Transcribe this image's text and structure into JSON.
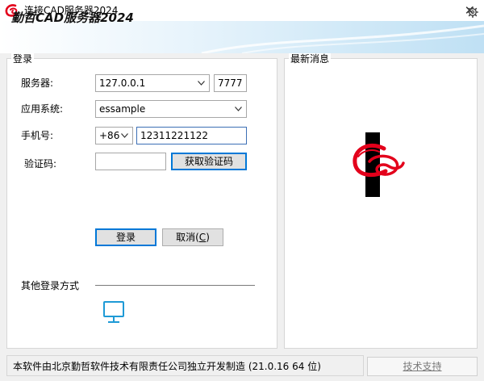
{
  "window": {
    "title": "连接CAD服务器2024",
    "close_glyph": "✕"
  },
  "banner": {
    "title": "勤哲CAD服务器2024",
    "settings_icon": "gear-icon"
  },
  "login": {
    "caption": "登录",
    "server_label": "服务器:",
    "server_value": "127.0.0.1",
    "port_value": "7777",
    "app_label": "应用系统:",
    "app_value": "essample",
    "phone_label": "手机号:",
    "country_code": "+86",
    "phone_value": "12311221122",
    "code_label": "验证码:",
    "code_value": "",
    "get_code_button": "获取验证码",
    "login_button": "登录",
    "cancel_button_prefix": "取消(",
    "cancel_button_key": "C",
    "cancel_button_suffix": ")",
    "other_methods_label": "其他登录方式",
    "other_method_icon": "monitor-icon"
  },
  "news": {
    "caption": "最新消息",
    "logo_icon": "company-logo-icon"
  },
  "footer": {
    "status_text": "本软件由北京勤哲软件技术有限责任公司独立开发制造 (21.0.16 64 位)",
    "support_button": "技术支持"
  },
  "colors": {
    "accent": "#0078d7",
    "logo_red": "#e3001b",
    "monitor_blue": "#1e9ad6"
  }
}
